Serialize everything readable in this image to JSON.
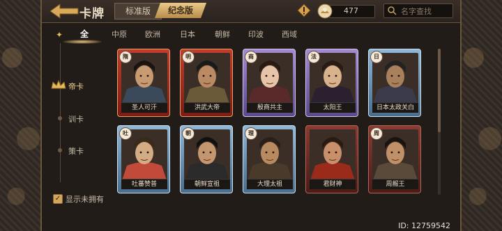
{
  "header": {
    "title": "卡牌",
    "tabs": [
      {
        "label": "标准版",
        "active": false
      },
      {
        "label": "纪念版",
        "active": true
      }
    ],
    "currency_value": "477",
    "search_placeholder": "名字查找"
  },
  "regions": [
    {
      "label": "全",
      "active": true
    },
    {
      "label": "中原",
      "active": false
    },
    {
      "label": "欧洲",
      "active": false
    },
    {
      "label": "日本",
      "active": false
    },
    {
      "label": "朝鲜",
      "active": false
    },
    {
      "label": "印波",
      "active": false
    },
    {
      "label": "西域",
      "active": false
    }
  ],
  "categories": [
    {
      "label": "帝卡",
      "active": true
    },
    {
      "label": "训卡",
      "active": false
    },
    {
      "label": "策卡",
      "active": false
    }
  ],
  "show_unowned": {
    "label": "显示未拥有",
    "checked": true
  },
  "cards": [
    {
      "name": "圣人可汗",
      "badge": "隋",
      "frame": "red"
    },
    {
      "name": "洪武大帝",
      "badge": "明",
      "frame": "red"
    },
    {
      "name": "殷商共主",
      "badge": "商",
      "frame": "purple"
    },
    {
      "name": "太阳王",
      "badge": "法",
      "frame": "purple"
    },
    {
      "name": "日本太政关白",
      "badge": "日",
      "frame": "blue"
    },
    {
      "name": "吐蕃赞普",
      "badge": "吐",
      "frame": "blue"
    },
    {
      "name": "朝鲜宣祖",
      "badge": "朝",
      "frame": "blue"
    },
    {
      "name": "大理太祖",
      "badge": "理",
      "frame": "blue"
    },
    {
      "name": "君财神",
      "badge": "",
      "frame": "maroon"
    },
    {
      "name": "周赧王",
      "badge": "周",
      "frame": "maroon"
    }
  ],
  "footer": {
    "id_text": "ID: 12759542"
  }
}
